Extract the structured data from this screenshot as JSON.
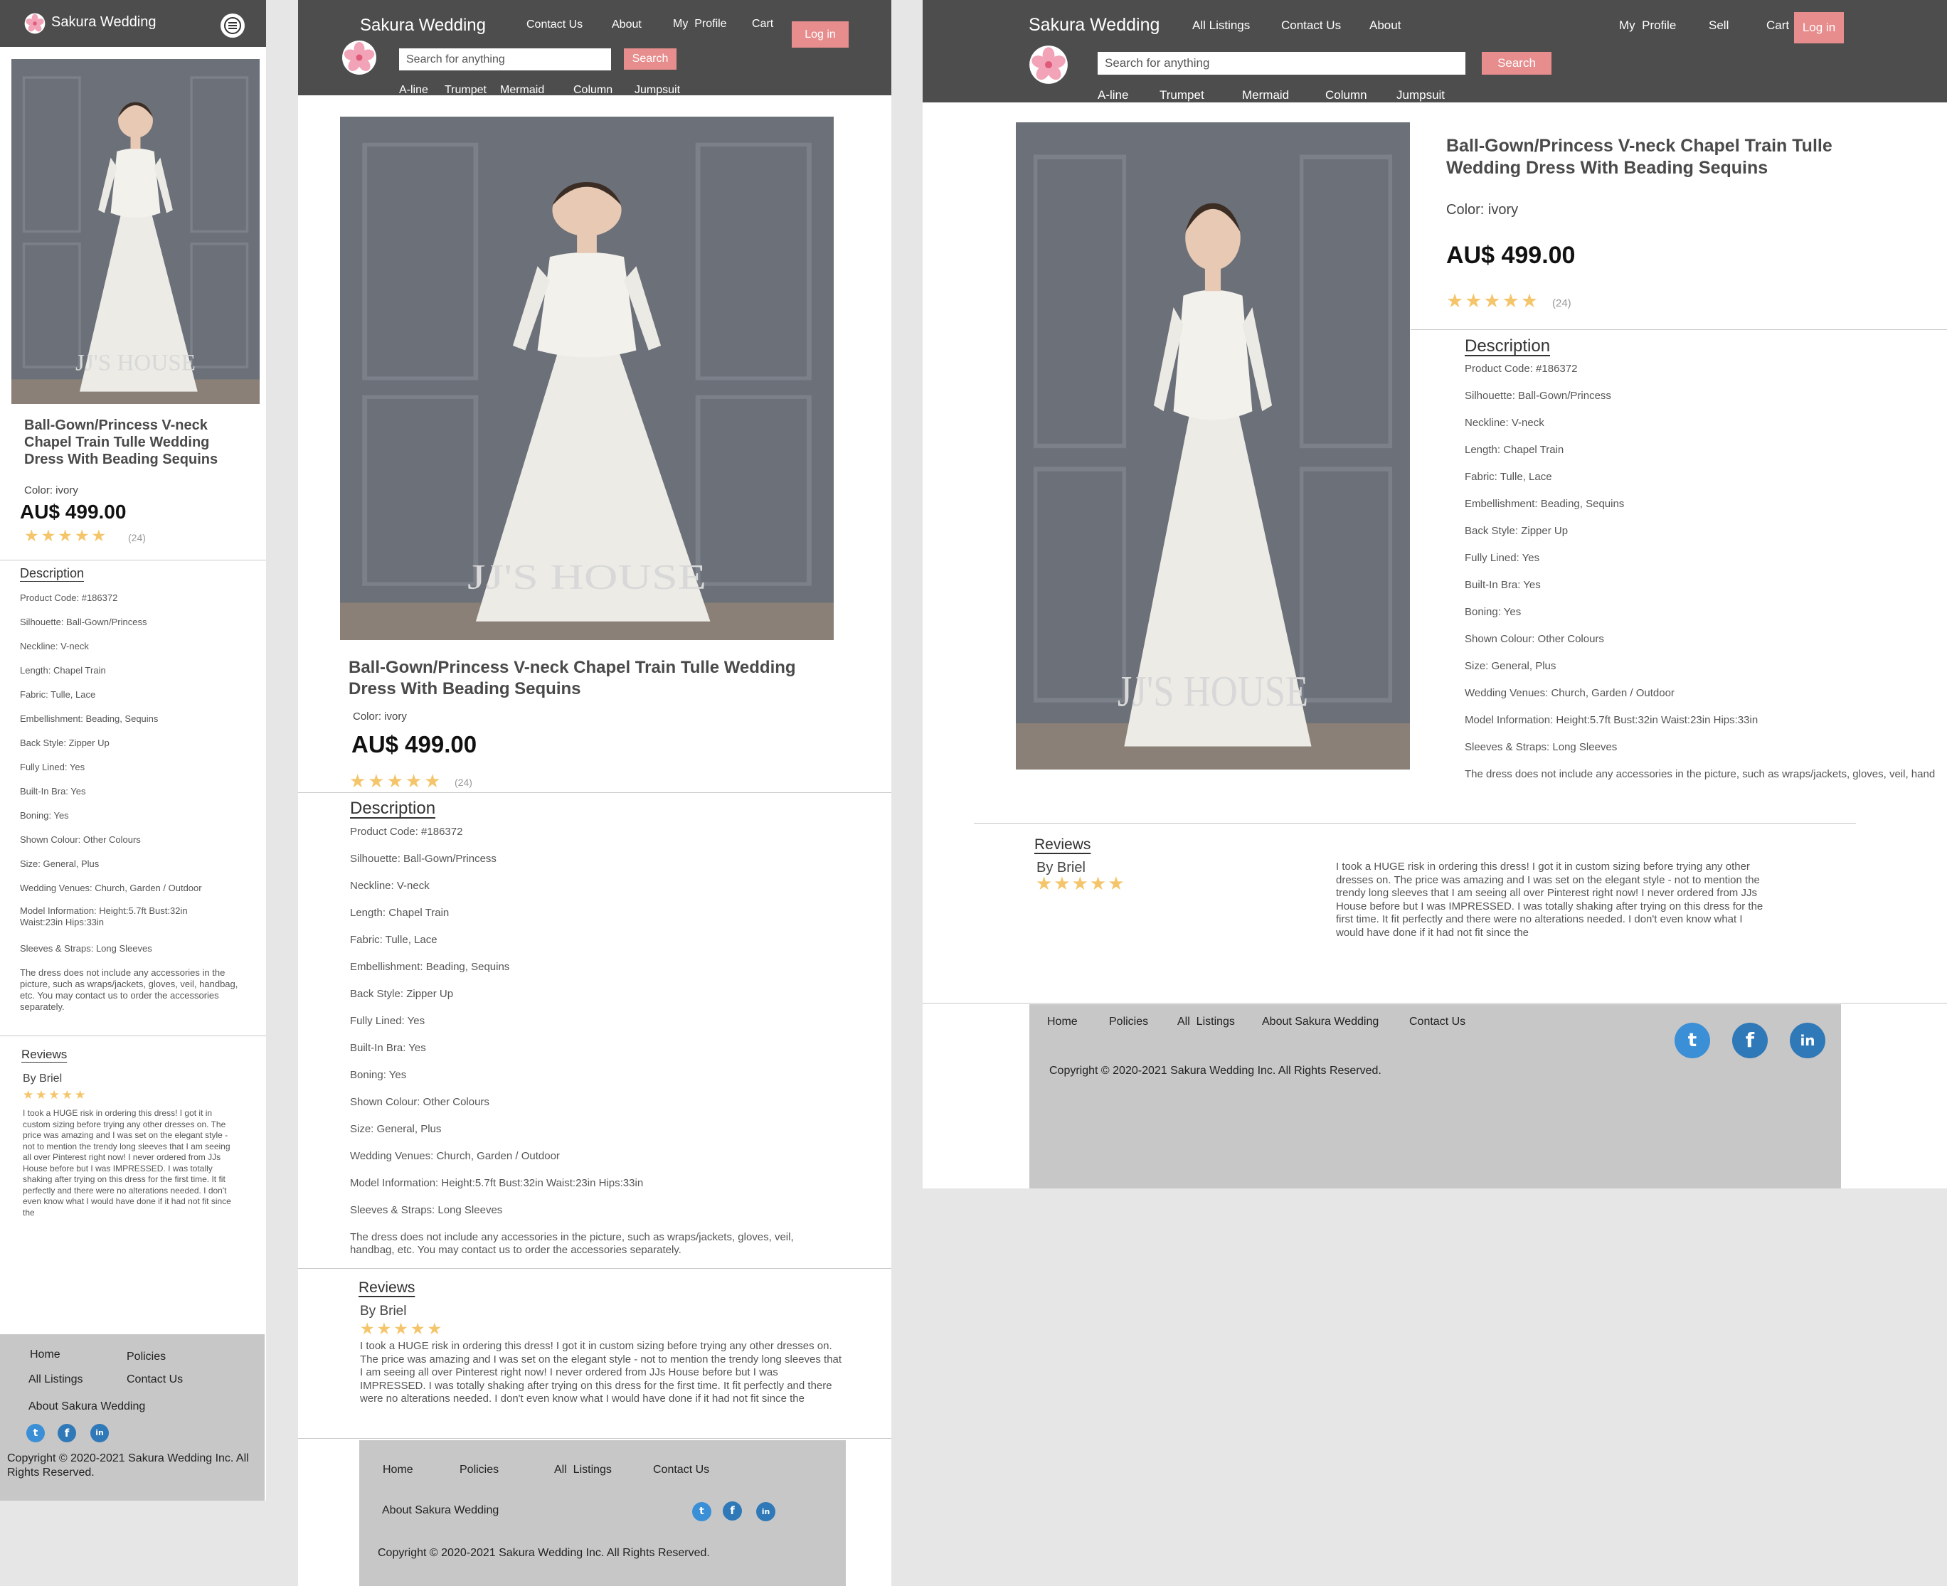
{
  "site": {
    "brand": "Sakura Wedding",
    "nav": {
      "all_listings": "All Listings",
      "contact": "Contact Us",
      "about": "About",
      "my_profile": "My  Profile",
      "sell": "Sell",
      "cart": "Cart",
      "login": "Log in"
    },
    "search": {
      "placeholder": "Search for anything",
      "button": "Search"
    },
    "categories": [
      "A-line",
      "Trumpet",
      "Mermaid",
      "Column",
      "Jumpsuit"
    ]
  },
  "product": {
    "title": "Ball-Gown/Princess V-neck Chapel Train Tulle Wedding Dress With Beading Sequins",
    "color": "Color: ivory",
    "price": "AU$ 499.00",
    "rating": 5,
    "rating_stars": "★★★★★",
    "review_count": "(24)",
    "watermark": "JJ'S HOUSE"
  },
  "description": {
    "heading": "Description",
    "specs": [
      "Product Code: #186372",
      "Silhouette: Ball-Gown/Princess",
      "Neckline: V-neck",
      "Length: Chapel Train",
      "Fabric: Tulle, Lace",
      "Embellishment: Beading, Sequins",
      "Back Style: Zipper Up",
      "Fully Lined: Yes",
      "Built-In Bra: Yes",
      "Boning: Yes",
      "Shown Colour: Other Colours",
      "Size: General, Plus",
      "Wedding Venues: Church, Garden / Outdoor",
      "Model Information: Height:5.7ft Bust:32in Waist:23in Hips:33in",
      "Sleeves & Straps: Long Sleeves"
    ],
    "note": "The dress does not include any accessories in the picture, such as wraps/jackets, gloves, veil, handbag, etc. You may contact us to order the accessories separately.",
    "note_cut": "The dress does not include any accessories in the picture, such as wraps/jackets, gloves, veil, hand"
  },
  "reviews": {
    "heading": "Reviews",
    "author": "By Briel",
    "stars": "★★★★★",
    "text": "I took a HUGE risk in ordering this dress! I got it in custom sizing before trying any other dresses on. The price was amazing and I was set on the elegant style - not to mention the trendy long sleeves that I am seeing all over Pinterest right now! I never ordered from JJs House before but I was IMPRESSED. I was totally shaking after trying on this dress for the first time. It fit perfectly and there were no alterations needed. I don't even know what I would have done if it had not fit since the"
  },
  "footer": {
    "home": "Home",
    "policies": "Policies",
    "all_listings": "All  Listings",
    "contact": "Contact Us",
    "about": "About Sakura Wedding",
    "copyright": "Copyright © 2020-2021 Sakura Wedding Inc. All Rights Reserved."
  },
  "colors": {
    "header": "#4d4d4d",
    "accent": "#e88d8d",
    "footer": "#c7c7c7",
    "star": "#f4c56a",
    "social": "#2f79b8"
  },
  "icons": [
    "sakura-logo-icon",
    "menu-icon",
    "star-icon",
    "twitter-icon",
    "facebook-icon",
    "linkedin-icon"
  ]
}
